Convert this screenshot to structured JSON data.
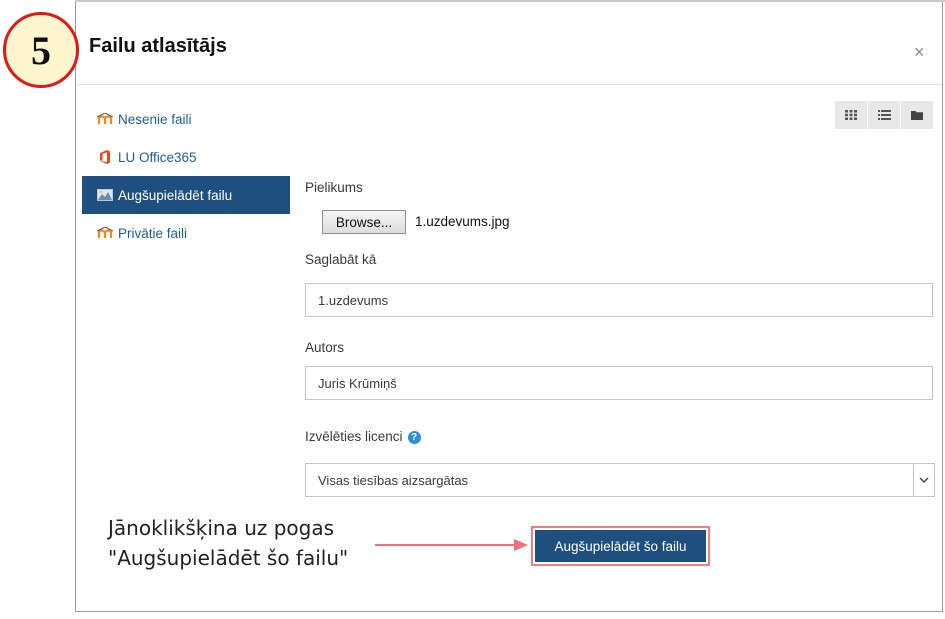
{
  "step_number": "5",
  "dialog": {
    "title": "Failu atlasītājs",
    "close_symbol": "×"
  },
  "nav": {
    "items": [
      {
        "label": "Nesenie faili",
        "icon": "moodle-icon",
        "active": false
      },
      {
        "label": "LU Office365",
        "icon": "office365-icon",
        "active": false
      },
      {
        "label": "Augšupielādēt failu",
        "icon": "upload-icon",
        "active": true
      },
      {
        "label": "Privātie faili",
        "icon": "moodle-icon",
        "active": false
      }
    ]
  },
  "view_buttons": [
    "grid-view-icon",
    "list-view-icon",
    "folder-view-icon"
  ],
  "form": {
    "attachment_label": "Pielikums",
    "browse_label": "Browse...",
    "selected_file": "1.uzdevums.jpg",
    "save_as_label": "Saglabāt kā",
    "save_as_value": "1.uzdevums",
    "author_label": "Autors",
    "author_value": "Juris Krūmiņš",
    "license_label": "Izvēlēties licenci",
    "license_value": "Visas tiesības aizsargātas",
    "upload_button": "Augšupielādēt šo failu"
  },
  "annotation": {
    "line1": "Jānoklikšķina uz pogas",
    "line2": "\"Augšupielādēt šo failu\""
  },
  "colors": {
    "accent": "#1f4f7e",
    "link": "#1d5e9b",
    "highlight_border": "#f37a87",
    "badge_border": "#e01818",
    "badge_fill": "#fff6cf"
  }
}
